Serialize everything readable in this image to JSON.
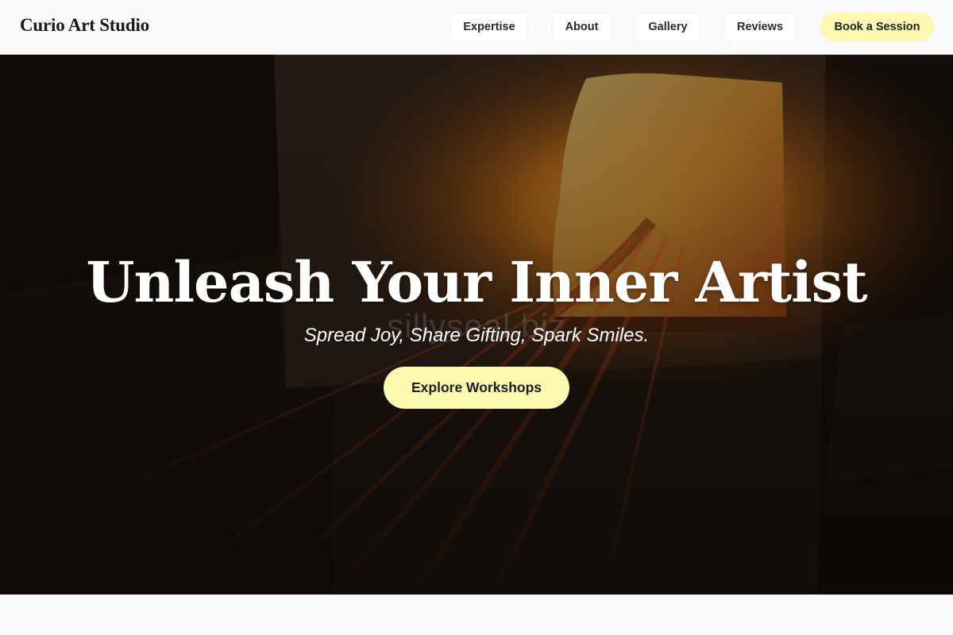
{
  "header": {
    "brand": "Curio Art Studio",
    "nav": {
      "expertise": "Expertise",
      "about": "About",
      "gallery": "Gallery",
      "reviews": "Reviews",
      "book": "Book a Session"
    }
  },
  "hero": {
    "title": "Unleash Your Inner Artist",
    "subtitle": "Spread Joy, Share Gifting, Spark Smiles.",
    "watermark": "sillyseal.biz",
    "cta": "Explore Workshops"
  },
  "colors": {
    "accent": "#fcf9b0",
    "header_bg": "#f9f9f9",
    "hero_overlay": "#1c150f"
  }
}
